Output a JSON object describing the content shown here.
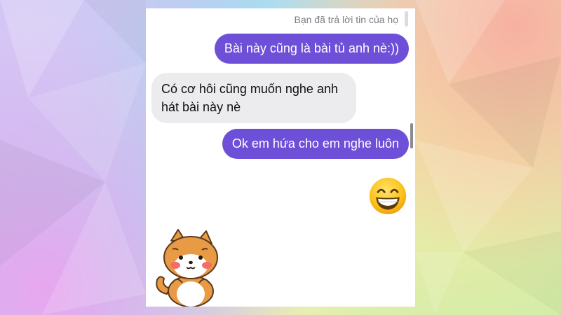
{
  "chat": {
    "status_text": "Bạn đã trả lời tin của họ",
    "messages": [
      {
        "sender": "me",
        "text": "Bài này cũng là bài tủ anh nè:))"
      },
      {
        "sender": "them",
        "text": "Có cơ hôi cũng muốn nghe anh hát bài này nè"
      },
      {
        "sender": "me",
        "text": "Ok em hứa cho em nghe luôn"
      }
    ],
    "reaction_emoji": "grinning-face-with-smiling-eyes",
    "sticker": "shiba-dog-sticker"
  },
  "colors": {
    "outgoing_bubble": "#6e4fd8",
    "incoming_bubble": "#ececef",
    "status_text": "#7c7c84"
  }
}
